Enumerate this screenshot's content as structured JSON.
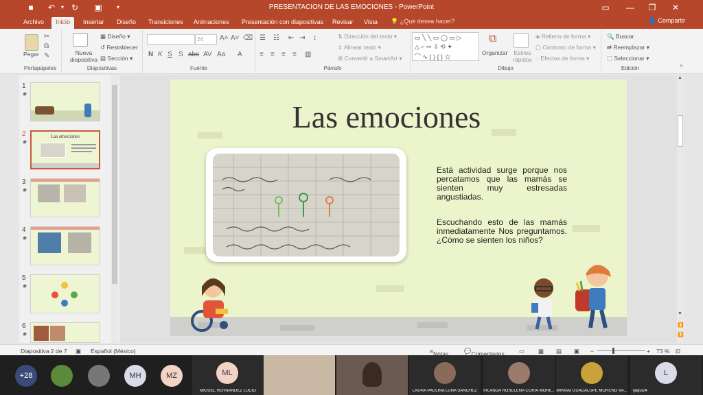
{
  "window": {
    "title": "PRESENTACION DE LAS EMOCIONES - PowerPoint"
  },
  "tabs": [
    "Archivo",
    "Inicio",
    "Insertar",
    "Diseño",
    "Transiciones",
    "Animaciones",
    "Presentación con diapositivas",
    "Revisar",
    "Vista"
  ],
  "tell_me": "¿Qué desea hacer?",
  "share": "Compartir",
  "ribbon": {
    "paste": "Pegar",
    "new_slide": "Nueva diapositiva",
    "layout": "Diseño",
    "reset": "Restablecer",
    "section": "Sección",
    "font_size": "24",
    "text_direction": "Dirección del texto",
    "align_text": "Alinear texto",
    "smartart": "Convertir a SmartArt",
    "arrange": "Organizar",
    "quick_styles": "Estilos rápidos",
    "shape_fill": "Relleno de forma",
    "shape_outline": "Contorno de forma",
    "shape_effects": "Efectos de forma",
    "find": "Buscar",
    "replace": "Reemplazar",
    "select": "Seleccionar",
    "groups": {
      "clipboard": "Portapapeles",
      "slides": "Diapositivas",
      "font": "Fuente",
      "paragraph": "Párrafo",
      "drawing": "Dibujo",
      "editing": "Edición"
    }
  },
  "thumbnails": [
    {
      "num": "1",
      "star": "★"
    },
    {
      "num": "2",
      "star": "★",
      "label": "Las emociones"
    },
    {
      "num": "3",
      "star": "★"
    },
    {
      "num": "4",
      "star": "★"
    },
    {
      "num": "5",
      "star": "★"
    },
    {
      "num": "6",
      "star": "★"
    }
  ],
  "slide": {
    "title": "Las emociones",
    "para1": "Está actividad surge porque nos percatamos que las mamás se sienten muy estresadas angustiadas.",
    "para2": "Escuchando esto de las mamás inmediatamente Nos preguntamos. ¿Cómo se sienten los niños?"
  },
  "status": {
    "slide_of": "Diapositiva 2 de 7",
    "language": "Español (México)",
    "notes": "Notas",
    "comments": "Comentarios",
    "zoom": "73 %"
  },
  "participants": {
    "count": "+28",
    "initials": [
      "MH",
      "MZ",
      "ML",
      "L"
    ],
    "names": [
      "MIGUEL HERNANDEZ LUCIO",
      "LAURA PAULINA LUNA SANCHEZ",
      "IRLANDA ROSELENA CORIA MORE...",
      "MIRIAM GUADALUPE MORENO VA...",
      "ljaqui24"
    ]
  },
  "colors": {
    "accent": "#b7472a",
    "slide_bg": "#ecf4cb"
  }
}
